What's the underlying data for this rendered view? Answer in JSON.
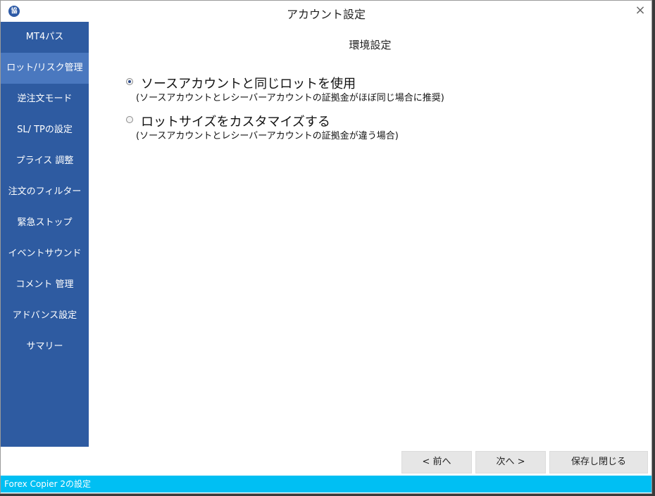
{
  "window": {
    "title": "アカウント設定",
    "app_icon_text": "協",
    "close_glyph": "×"
  },
  "sidebar": {
    "items": [
      {
        "label": "MT4パス"
      },
      {
        "label": "ロット/リスク管理",
        "active": true
      },
      {
        "label": "逆注文モード"
      },
      {
        "label": "SL/ TPの設定"
      },
      {
        "label": "プライス 調整"
      },
      {
        "label": "注文のフィルター"
      },
      {
        "label": "緊急ストップ"
      },
      {
        "label": "イベントサウンド"
      },
      {
        "label": "コメント 管理"
      },
      {
        "label": "アドバンス設定"
      },
      {
        "label": "サマリー"
      }
    ]
  },
  "main": {
    "section_title": "環境設定",
    "options": [
      {
        "label": "ソースアカウントと同じロットを使用",
        "description": "(ソースアカウントとレシーバーアカウントの証拠金がほぼ同じ場合に推奨)",
        "checked": true
      },
      {
        "label": "ロットサイズをカスタマイズする",
        "description": "(ソースアカウントとレシーバーアカウントの証拠金が違う場合)",
        "checked": false
      }
    ]
  },
  "buttons": {
    "prev": "< 前へ",
    "next": "次へ >",
    "save_close": "保存し閉じる"
  },
  "status_bar": {
    "text": "Forex Copier 2の設定"
  },
  "colors": {
    "sidebar_bg": "#2e5ba1",
    "sidebar_active": "#4a78bf",
    "status_bar": "#00bff3"
  }
}
